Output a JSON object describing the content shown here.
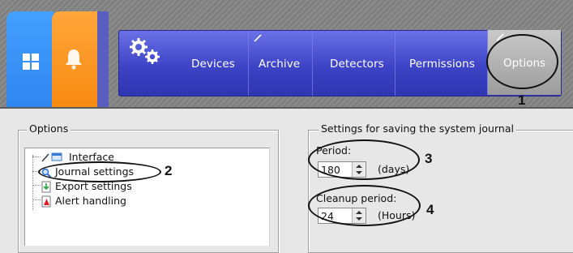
{
  "nav": {
    "items": [
      "Devices",
      "Archive",
      "Detectors",
      "Permissions"
    ],
    "active": "Options"
  },
  "options_panel": {
    "title": "Options",
    "tree": [
      {
        "label": "Interface",
        "icon": "interface-icon"
      },
      {
        "label": "Journal settings",
        "icon": "journal-icon"
      },
      {
        "label": "Export settings",
        "icon": "export-icon"
      },
      {
        "label": "Alert handling",
        "icon": "alert-icon"
      }
    ]
  },
  "journal_settings": {
    "title": "Settings for saving the system journal",
    "period": {
      "label": "Period:",
      "value": "180",
      "unit": "(days)"
    },
    "cleanup": {
      "label": "Cleanup period:",
      "value": "24",
      "unit": "(Hours)"
    }
  },
  "callouts": [
    "1",
    "2",
    "3",
    "4"
  ],
  "colors": {
    "tile_blue": "#2f86ef",
    "tile_orange": "#f78b12",
    "nav_blue": "#3d44c6",
    "options_tab": "#b0b0b0"
  }
}
